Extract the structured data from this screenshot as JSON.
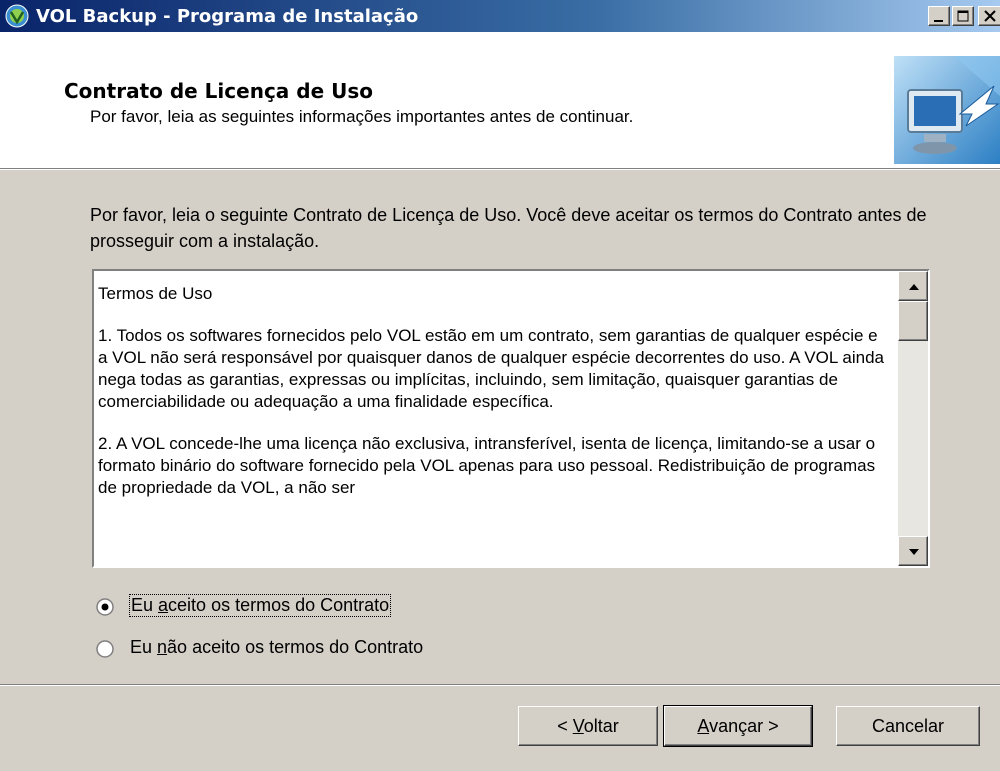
{
  "window": {
    "title": "VOL Backup - Programa de Instalação",
    "icon": "vol-app-icon",
    "controls": {
      "minimize": "minimize-icon",
      "maximize": "maximize-icon",
      "close": "close-icon"
    }
  },
  "header": {
    "title": "Contrato de Licença de Uso",
    "subtitle": "Por favor, leia as seguintes informações importantes antes de continuar.",
    "image": "wizard-computer-icon"
  },
  "intro": "Por favor, leia o seguinte Contrato de Licença de Uso. Você deve aceitar os termos do Contrato antes de prosseguir com a instalação.",
  "license": {
    "paragraphs": [
      "Termos de Uso",
      "1. Todos os softwares fornecidos pelo VOL estão em um contrato, sem garantias de qualquer espécie e a VOL não será responsável por quaisquer danos de qualquer espécie decorrentes do uso. A VOL ainda nega todas as garantias, expressas ou implícitas, incluindo, sem limitação, quaisquer garantias de comerciabilidade ou adequação a uma finalidade específica.",
      "2. A VOL concede-lhe uma licença não exclusiva, intransferível, isenta de licença, limitando-se a usar o formato binário do software fornecido pela VOL apenas para uso pessoal. Redistribuição de programas de propriedade da VOL, a não ser"
    ]
  },
  "options": {
    "accept": {
      "pre": "Eu ",
      "access": "a",
      "post": "ceito os termos do Contrato",
      "selected": true
    },
    "decline": {
      "pre": "Eu ",
      "access": "n",
      "post": "ão aceito os termos do Contrato",
      "selected": false
    }
  },
  "buttons": {
    "back": {
      "pre": "< ",
      "access": "V",
      "post": "oltar"
    },
    "next": {
      "pre": "",
      "access": "A",
      "post": "vançar >"
    },
    "cancel": "Cancelar"
  },
  "colors": {
    "titlebar_start": "#0a246a",
    "titlebar_end": "#a6caf0",
    "face": "#d4d0c8"
  }
}
